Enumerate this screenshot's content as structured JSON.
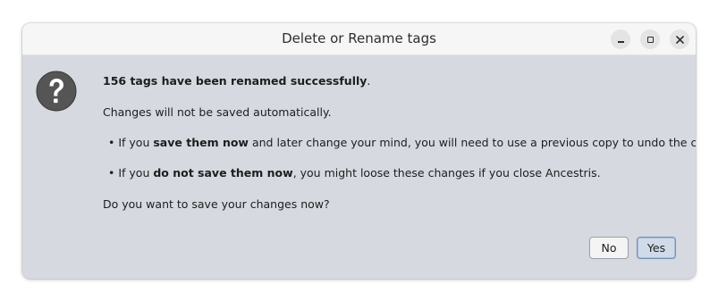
{
  "dialog": {
    "title": "Delete or Rename tags",
    "icon": "question-icon",
    "message": {
      "line1_bold": "156 tags have been renamed successfully",
      "line1_end": ".",
      "line2": "Changes will not be saved automatically.",
      "bullet1_prefix": "• If you ",
      "bullet1_bold": "save them now",
      "bullet1_rest": " and later change your mind, you will need to use a previous copy to undo the changes.",
      "bullet2_prefix": "• If you ",
      "bullet2_bold": "do not save them now",
      "bullet2_rest": ", you might loose these changes if you close Ancestris.",
      "question": "Do you want to save your changes now?"
    },
    "buttons": {
      "no": "No",
      "yes": "Yes"
    }
  },
  "window_controls": {
    "minimize_icon": "minimize-icon",
    "maximize_icon": "maximize-icon",
    "close_icon": "close-icon"
  },
  "colors": {
    "dialog_background": "#d6d9e0",
    "titlebar_background": "#f6f6f6",
    "icon_background": "#4a4a4a",
    "default_button_background": "#cfdbe9",
    "default_button_border": "#6f8fb3"
  }
}
